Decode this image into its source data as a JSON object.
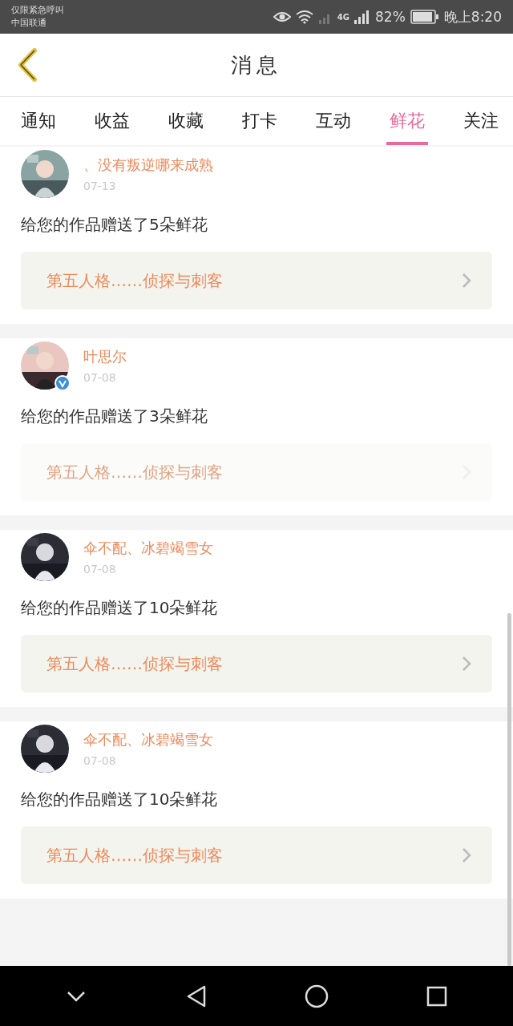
{
  "status_bar": {
    "carrier_lines": [
      "仅限紧急呼叫",
      "中国联通"
    ],
    "network": "4G",
    "battery": "82%",
    "time": "晚上8:20"
  },
  "header": {
    "title": "消息"
  },
  "tabs": [
    {
      "label": "通知",
      "selected": false
    },
    {
      "label": "收益",
      "selected": false
    },
    {
      "label": "收藏",
      "selected": false
    },
    {
      "label": "打卡",
      "selected": false
    },
    {
      "label": "互动",
      "selected": false
    },
    {
      "label": "鲜花",
      "selected": true
    },
    {
      "label": "关注",
      "selected": false
    }
  ],
  "messages": [
    {
      "name": "、没有叛逆哪来成熟",
      "date": "07-13",
      "verified": false,
      "text": "给您的作品赠送了5朵鲜花",
      "work": {
        "title": "第五人格……侦探与刺客",
        "disabled": false
      }
    },
    {
      "name": "叶思尔",
      "date": "07-08",
      "verified": true,
      "text": "给您的作品赠送了3朵鲜花",
      "work": {
        "title": "第五人格……侦探与刺客",
        "disabled": true
      }
    },
    {
      "name": "伞不配、冰碧竭雪女",
      "date": "07-08",
      "verified": false,
      "text": "给您的作品赠送了10朵鲜花",
      "work": {
        "title": "第五人格……侦探与刺客",
        "disabled": false
      }
    },
    {
      "name": "伞不配、冰碧竭雪女",
      "date": "07-08",
      "verified": false,
      "text": "给您的作品赠送了10朵鲜花",
      "work": {
        "title": "第五人格……侦探与刺客",
        "disabled": false
      }
    }
  ]
}
